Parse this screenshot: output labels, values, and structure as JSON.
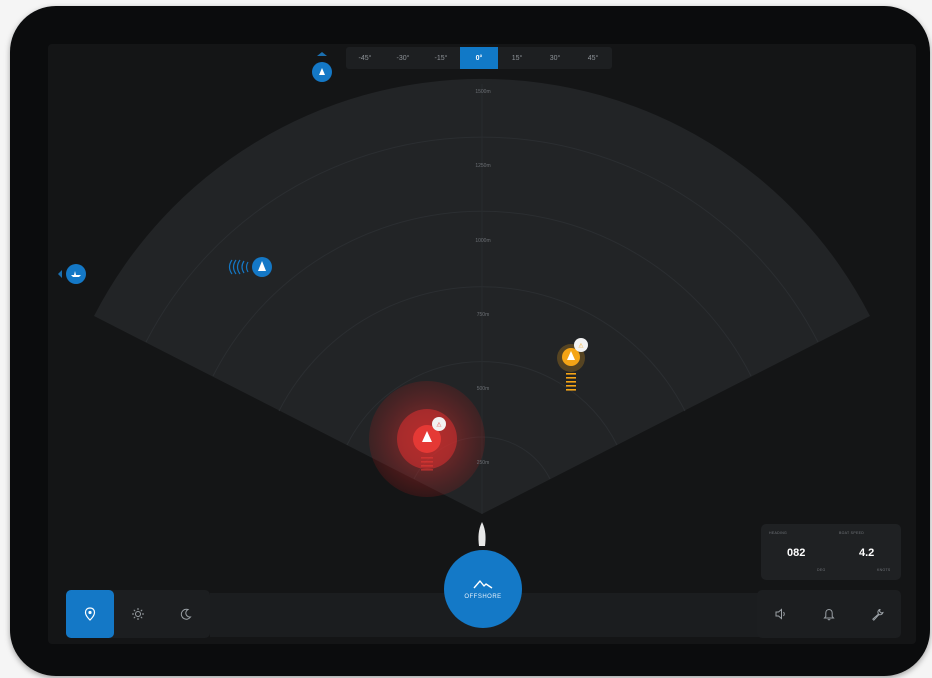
{
  "angles": [
    "-45°",
    "-30°",
    "-15°",
    "0°",
    "15°",
    "30°",
    "45°"
  ],
  "active_angle": "0°",
  "ranges": [
    "1500m",
    "1250m",
    "1000m",
    "750m",
    "500m",
    "250m"
  ],
  "center_button": {
    "label": "OFFSHORE",
    "icon": "wave-icon"
  },
  "left_tools": [
    {
      "name": "location",
      "icon": "location-pin-icon",
      "active": true
    },
    {
      "name": "day-mode",
      "icon": "sun-icon",
      "active": false
    },
    {
      "name": "night-mode",
      "icon": "moon-icon",
      "active": false
    }
  ],
  "right_tools": [
    {
      "name": "volume",
      "icon": "speaker-icon"
    },
    {
      "name": "alerts",
      "icon": "bell-icon"
    },
    {
      "name": "settings",
      "icon": "wrench-icon"
    }
  ],
  "stats": {
    "heading_caption": "HEADING",
    "heading_value": "082",
    "heading_unit": "DEG",
    "speed_caption": "BOAT SPEED",
    "speed_value": "4.2",
    "speed_unit": "KNOTS"
  },
  "colors": {
    "accent": "#1478c6",
    "danger": "#e53935",
    "warning": "#f4a416",
    "background": "#141516"
  }
}
